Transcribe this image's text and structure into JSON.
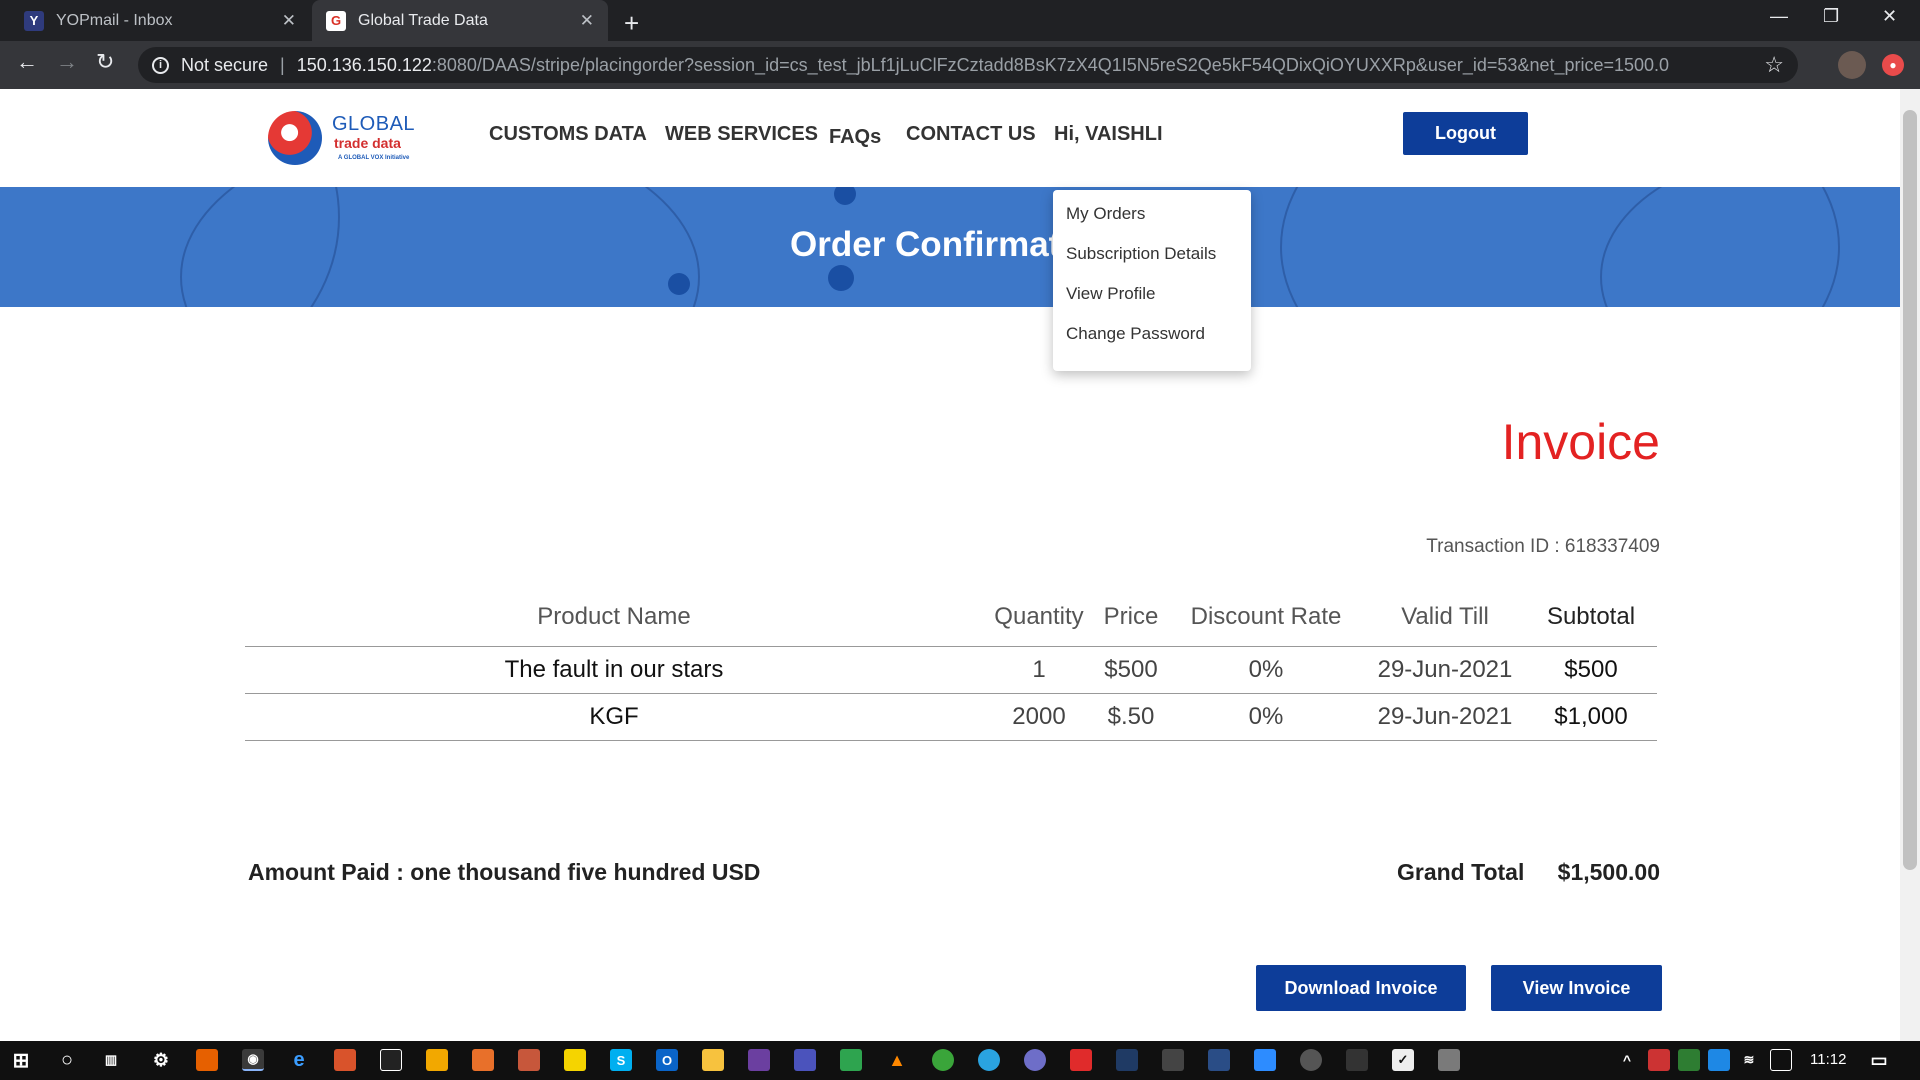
{
  "browser": {
    "tabs": [
      {
        "title": "YOPmail - Inbox",
        "favicon": "Y"
      },
      {
        "title": "Global Trade Data",
        "favicon": "G"
      }
    ],
    "security_label": "Not secure",
    "url_host": "150.136.150.122",
    "url_path": ":8080/DAAS/stripe/placingorder?session_id=cs_test_jbLf1jLuClFzCztadd8BsK7zX4Q1I5N5reS2Qe5kF54QDixQiOYUXXRp&user_id=53&net_price=1500.0"
  },
  "site": {
    "logo": {
      "line1": "GLOBAL",
      "line2": "trade data",
      "line3": "A GLOBAL VOX Initiative"
    },
    "nav": [
      "CUSTOMS DATA",
      "WEB SERVICES",
      "FAQs",
      "CONTACT US",
      "Hi, VAISHLI"
    ],
    "logout_label": "Logout",
    "banner_title": "Order Confirmat",
    "user_menu": [
      "My Orders",
      "Subscription Details",
      "View Profile",
      "Change Password"
    ]
  },
  "invoice": {
    "title": "Invoice",
    "transaction": "Transaction ID : 618337409",
    "headers": [
      "Product Name",
      "Quantity",
      "Price",
      "Discount Rate",
      "Valid Till",
      "Subtotal"
    ],
    "rows": [
      [
        "The fault in our stars",
        "1",
        "$500",
        "0%",
        "29-Jun-2021",
        "$500"
      ],
      [
        "KGF",
        "2000",
        "$.50",
        "0%",
        "29-Jun-2021",
        "$1,000"
      ]
    ],
    "amount_paid": "Amount Paid : one thousand five hundred USD",
    "grand_total_label": "Grand Total",
    "grand_total_value": "$1,500.00",
    "download_label": "Download Invoice",
    "view_label": "View Invoice"
  },
  "taskbar": {
    "clock": "11:12"
  },
  "colors": {
    "brand_blue": "#0d3d99",
    "banner_blue": "#3d77c8",
    "invoice_red": "#e32222"
  }
}
